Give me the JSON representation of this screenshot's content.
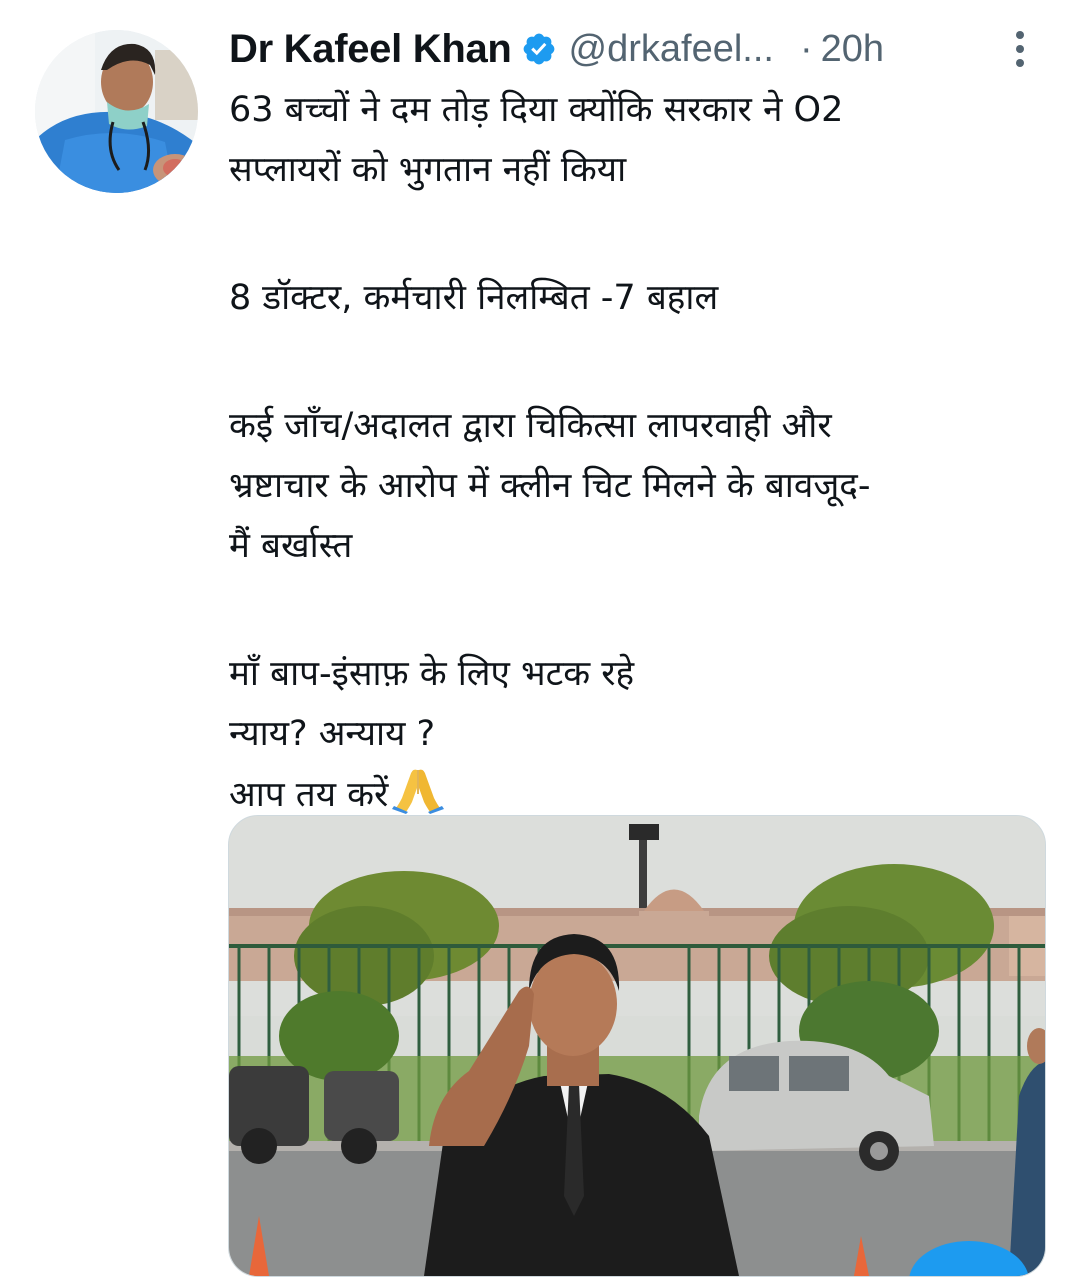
{
  "tweet": {
    "author": {
      "display_name": "Dr Kafeel Khan",
      "handle": "@drkafeel...",
      "verified": true,
      "verified_color": "#1d9bf0"
    },
    "separator": "·",
    "time": "20h",
    "lines": [
      "63 बच्चों ने दम तोड़ दिया क्योंकि सरकार ने O2",
      "सप्लायरों को भुगतान नहीं किया",
      "",
      "8 डॉक्टर, कर्मचारी निलम्बित -7 बहाल",
      "",
      "कई जाँच/अदालत द्वारा चिकित्सा लापरवाही और",
      "भ्रष्टाचार के आरोप में क्लीन चिट मिलने के बावजूद-",
      "मैं बर्खास्त",
      "",
      "माँ बाप-इंसाफ़ के लिए भटक रहे",
      "न्याय? अन्याय ?",
      "आप तय करें"
    ],
    "emoji": "folded-hands-emoji",
    "media": {
      "type": "photo",
      "accent": "#1d9bf0"
    }
  },
  "colors": {
    "text": "#0f1419",
    "secondary": "#536471",
    "accent": "#1d9bf0"
  }
}
